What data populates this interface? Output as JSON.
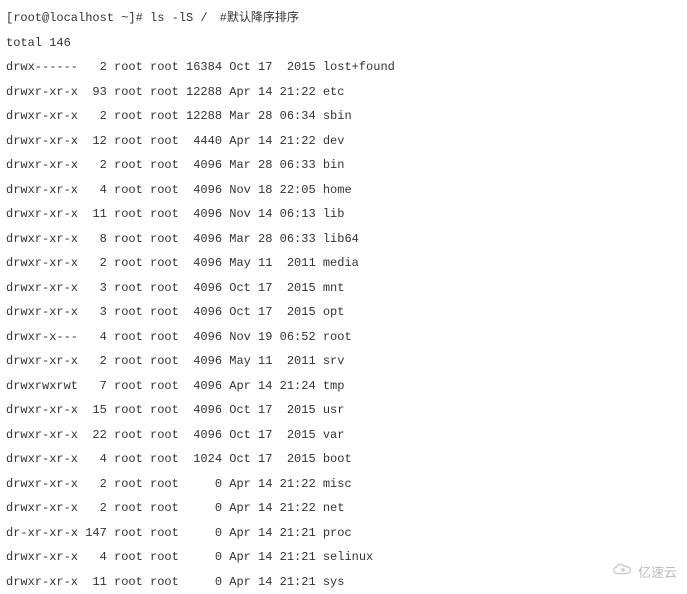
{
  "prompt": "[root@localhost ~]# ",
  "command": "ls -lS /",
  "comment": "#默认降序排序",
  "total_label": "total",
  "total_value": "146",
  "watermark_text": "亿速云",
  "rows": [
    {
      "perms": "drwx------",
      "links": "2",
      "owner": "root",
      "group": "root",
      "size": "16384",
      "month": "Oct",
      "day": "17",
      "time": "2015",
      "name": "lost+found"
    },
    {
      "perms": "drwxr-xr-x",
      "links": "93",
      "owner": "root",
      "group": "root",
      "size": "12288",
      "month": "Apr",
      "day": "14",
      "time": "21:22",
      "name": "etc"
    },
    {
      "perms": "drwxr-xr-x",
      "links": "2",
      "owner": "root",
      "group": "root",
      "size": "12288",
      "month": "Mar",
      "day": "28",
      "time": "06:34",
      "name": "sbin"
    },
    {
      "perms": "drwxr-xr-x",
      "links": "12",
      "owner": "root",
      "group": "root",
      "size": "4440",
      "month": "Apr",
      "day": "14",
      "time": "21:22",
      "name": "dev"
    },
    {
      "perms": "drwxr-xr-x",
      "links": "2",
      "owner": "root",
      "group": "root",
      "size": "4096",
      "month": "Mar",
      "day": "28",
      "time": "06:33",
      "name": "bin"
    },
    {
      "perms": "drwxr-xr-x",
      "links": "4",
      "owner": "root",
      "group": "root",
      "size": "4096",
      "month": "Nov",
      "day": "18",
      "time": "22:05",
      "name": "home"
    },
    {
      "perms": "drwxr-xr-x",
      "links": "11",
      "owner": "root",
      "group": "root",
      "size": "4096",
      "month": "Nov",
      "day": "14",
      "time": "06:13",
      "name": "lib"
    },
    {
      "perms": "drwxr-xr-x",
      "links": "8",
      "owner": "root",
      "group": "root",
      "size": "4096",
      "month": "Mar",
      "day": "28",
      "time": "06:33",
      "name": "lib64"
    },
    {
      "perms": "drwxr-xr-x",
      "links": "2",
      "owner": "root",
      "group": "root",
      "size": "4096",
      "month": "May",
      "day": "11",
      "time": "2011",
      "name": "media"
    },
    {
      "perms": "drwxr-xr-x",
      "links": "3",
      "owner": "root",
      "group": "root",
      "size": "4096",
      "month": "Oct",
      "day": "17",
      "time": "2015",
      "name": "mnt"
    },
    {
      "perms": "drwxr-xr-x",
      "links": "3",
      "owner": "root",
      "group": "root",
      "size": "4096",
      "month": "Oct",
      "day": "17",
      "time": "2015",
      "name": "opt"
    },
    {
      "perms": "drwxr-x---",
      "links": "4",
      "owner": "root",
      "group": "root",
      "size": "4096",
      "month": "Nov",
      "day": "19",
      "time": "06:52",
      "name": "root"
    },
    {
      "perms": "drwxr-xr-x",
      "links": "2",
      "owner": "root",
      "group": "root",
      "size": "4096",
      "month": "May",
      "day": "11",
      "time": "2011",
      "name": "srv"
    },
    {
      "perms": "drwxrwxrwt",
      "links": "7",
      "owner": "root",
      "group": "root",
      "size": "4096",
      "month": "Apr",
      "day": "14",
      "time": "21:24",
      "name": "tmp"
    },
    {
      "perms": "drwxr-xr-x",
      "links": "15",
      "owner": "root",
      "group": "root",
      "size": "4096",
      "month": "Oct",
      "day": "17",
      "time": "2015",
      "name": "usr"
    },
    {
      "perms": "drwxr-xr-x",
      "links": "22",
      "owner": "root",
      "group": "root",
      "size": "4096",
      "month": "Oct",
      "day": "17",
      "time": "2015",
      "name": "var"
    },
    {
      "perms": "drwxr-xr-x",
      "links": "4",
      "owner": "root",
      "group": "root",
      "size": "1024",
      "month": "Oct",
      "day": "17",
      "time": "2015",
      "name": "boot"
    },
    {
      "perms": "drwxr-xr-x",
      "links": "2",
      "owner": "root",
      "group": "root",
      "size": "0",
      "month": "Apr",
      "day": "14",
      "time": "21:22",
      "name": "misc"
    },
    {
      "perms": "drwxr-xr-x",
      "links": "2",
      "owner": "root",
      "group": "root",
      "size": "0",
      "month": "Apr",
      "day": "14",
      "time": "21:22",
      "name": "net"
    },
    {
      "perms": "dr-xr-xr-x",
      "links": "147",
      "owner": "root",
      "group": "root",
      "size": "0",
      "month": "Apr",
      "day": "14",
      "time": "21:21",
      "name": "proc"
    },
    {
      "perms": "drwxr-xr-x",
      "links": "4",
      "owner": "root",
      "group": "root",
      "size": "0",
      "month": "Apr",
      "day": "14",
      "time": "21:21",
      "name": "selinux"
    },
    {
      "perms": "drwxr-xr-x",
      "links": "11",
      "owner": "root",
      "group": "root",
      "size": "0",
      "month": "Apr",
      "day": "14",
      "time": "21:21",
      "name": "sys"
    }
  ]
}
